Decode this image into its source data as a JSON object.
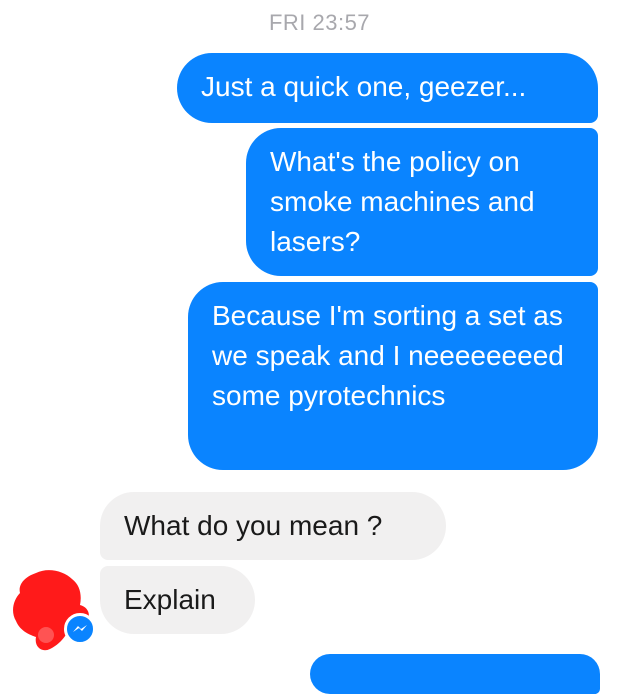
{
  "thread": {
    "timestamp": "FRI 23:57"
  },
  "messages": [
    {
      "direction": "outgoing",
      "text": "Just a quick one, geezer..."
    },
    {
      "direction": "outgoing",
      "text": "What's the policy on smoke machines and lasers?"
    },
    {
      "direction": "outgoing",
      "text": "Because I'm sorting a set as we speak and I neeeeeeeed some pyrotechnics"
    },
    {
      "direction": "incoming",
      "text": "What do you mean ?"
    },
    {
      "direction": "incoming",
      "text": "Explain"
    },
    {
      "direction": "outgoing",
      "text": ""
    }
  ],
  "avatar": {
    "icon": "redacted-avatar-icon",
    "badge_icon": "messenger-badge-icon"
  },
  "colors": {
    "outgoing_bubble": "#0a84ff",
    "incoming_bubble": "#f1f0f0",
    "timestamp": "#a8a8ad",
    "avatar_redaction": "#ff1a1a"
  }
}
